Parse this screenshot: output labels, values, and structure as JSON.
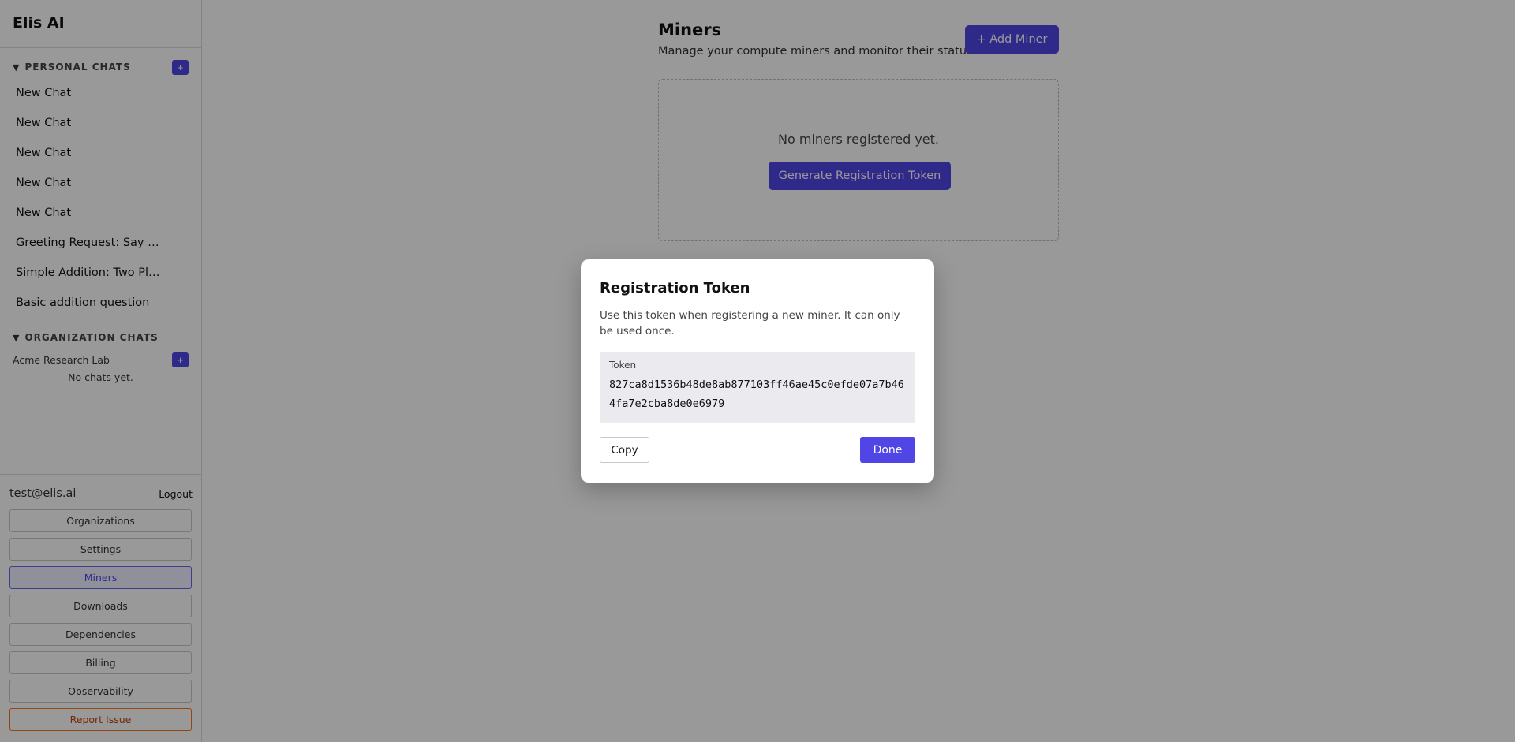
{
  "app": {
    "brand": "Elis AI"
  },
  "sidebar": {
    "personal": {
      "title": "PERSONAL CHATS",
      "toggle_icon": "triangle-down-icon",
      "add_label": "+",
      "chats": [
        "New Chat",
        "New Chat",
        "New Chat",
        "New Chat",
        "New Chat",
        "Greeting Request: Say …",
        "Simple Addition: Two Pl…",
        "Basic addition question"
      ]
    },
    "organization": {
      "title": "ORGANIZATION CHATS",
      "org_name": "Acme Research Lab",
      "add_label": "+",
      "empty": "No chats yet."
    },
    "user": {
      "email": "test@elis.ai",
      "logout": "Logout"
    },
    "nav": [
      {
        "label": "Organizations",
        "state": "default"
      },
      {
        "label": "Settings",
        "state": "default"
      },
      {
        "label": "Miners",
        "state": "active"
      },
      {
        "label": "Downloads",
        "state": "default"
      },
      {
        "label": "Dependencies",
        "state": "default"
      },
      {
        "label": "Billing",
        "state": "default"
      },
      {
        "label": "Observability",
        "state": "default"
      },
      {
        "label": "Report Issue",
        "state": "warning"
      }
    ]
  },
  "main": {
    "title": "Miners",
    "subtitle": "Manage your compute miners and monitor their status.",
    "add_button": "+ Add Miner",
    "empty_text": "No miners registered yet.",
    "generate_button": "Generate Registration Token"
  },
  "modal": {
    "title": "Registration Token",
    "description": "Use this token when registering a new miner. It can only be used once.",
    "token_label": "Token",
    "token_value": "827ca8d1536b48de8ab877103ff46ae45c0efde07a7b464fa7e2cba8de0e6979",
    "copy_button": "Copy",
    "done_button": "Done"
  },
  "colors": {
    "accent": "#4f46e5",
    "warning": "#f97316",
    "overlay": "rgba(0,0,0,0.4)"
  }
}
